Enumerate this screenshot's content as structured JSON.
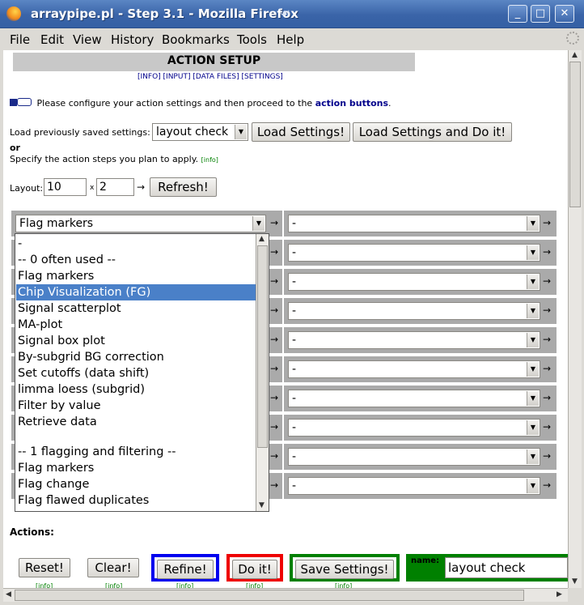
{
  "window": {
    "title": "arraypipe.pl - Step 3.1 - Mozilla Firefox",
    "buttons": [
      "_",
      "□",
      "✕"
    ]
  },
  "menubar": [
    "File",
    "Edit",
    "View",
    "History",
    "Bookmarks",
    "Tools",
    "Help"
  ],
  "page": {
    "header": "ACTION SETUP",
    "links": "[INFO] [INPUT] [DATA FILES] [SETTINGS]",
    "instruction_pre": "Please configure your action settings and then proceed to the ",
    "instruction_link": "action buttons",
    "instruction_post": ".",
    "load_label": "Load previously saved settings:",
    "load_value": "layout check",
    "load_button": "Load Settings!",
    "load_do_button": "Load Settings and Do it!",
    "or_text": "or",
    "specify_text": "Specify the action steps you plan to apply.",
    "info_tag": "[info]",
    "layout_label": "Layout:",
    "layout_cols": "10",
    "layout_x": "x",
    "layout_rows": "2",
    "refresh_button": "Refresh!",
    "arrow": "→",
    "first_step_value": "Flag markers",
    "empty_step_value": "-",
    "dropdown_options": [
      "-",
      "-- 0 often used --",
      "Flag markers",
      "Chip Visualization (FG)",
      "Signal scatterplot",
      "MA-plot",
      "Signal box plot",
      "By-subgrid BG correction",
      "Set cutoffs (data shift)",
      "limma loess (subgrid)",
      "Filter by value",
      "Retrieve data",
      "",
      "-- 1 flagging and filtering --",
      "Flag markers",
      "Flag change",
      "Flag flawed duplicates"
    ],
    "dropdown_selected_index": 3,
    "actions_label": "Actions:",
    "reset_button": "Reset!",
    "clear_button": "Clear!",
    "refine_button": "Refine!",
    "doit_button": "Do it!",
    "save_button": "Save Settings!",
    "name_label": "name:",
    "name_value": "layout check",
    "colors": {
      "refine_border": "#0000ee",
      "doit_border": "#ee0000",
      "save_border": "#008000",
      "selected_option": "#4a80c8"
    }
  }
}
